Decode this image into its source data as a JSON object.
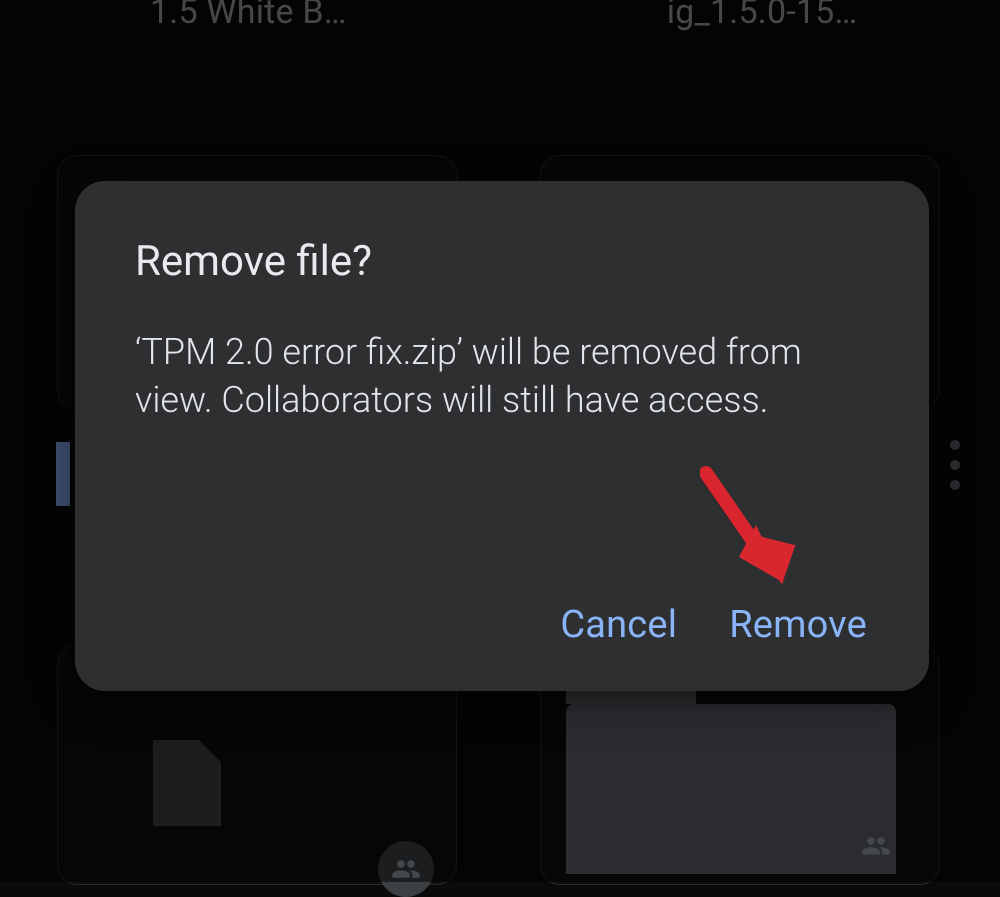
{
  "background": {
    "top_items": [
      "1.5 White B…",
      "ig_1.5.0-15…"
    ]
  },
  "dialog": {
    "title": "Remove file?",
    "body": "‘TPM 2.0 error fix.zip’ will be removed from view. Collaborators will still have access.",
    "cancel_label": "Cancel",
    "confirm_label": "Remove"
  },
  "colors": {
    "accent": "#8ab4f8",
    "surface": "#2e2f31",
    "annotation_arrow": "#d9272e"
  }
}
